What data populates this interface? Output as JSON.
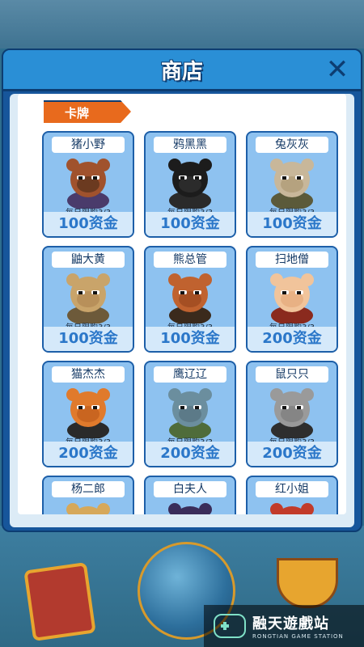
{
  "dialog": {
    "title": "商店",
    "close_glyph": "✕",
    "section_tab": "卡牌"
  },
  "cards": [
    {
      "name": "猪小野",
      "limit": "每日限购3/3",
      "price": "100资金",
      "palette": {
        "skin": "#a0522d",
        "face": "#6b3a20",
        "body": "#4a3b6b"
      }
    },
    {
      "name": "鸦黑黑",
      "limit": "每日限购3/3",
      "price": "100资金",
      "palette": {
        "skin": "#1c1c1c",
        "face": "#2b2b2b",
        "body": "#2a2a2a"
      }
    },
    {
      "name": "兔灰灰",
      "limit": "每日限购3/3",
      "price": "100资金",
      "palette": {
        "skin": "#c8b79a",
        "face": "#b5a27f",
        "body": "#5b5a3a"
      }
    },
    {
      "name": "鼬大黄",
      "limit": "每日限购3/3",
      "price": "100资金",
      "palette": {
        "skin": "#c9a46a",
        "face": "#b8905a",
        "body": "#6d5a3a"
      }
    },
    {
      "name": "熊总管",
      "limit": "每日限购3/3",
      "price": "100资金",
      "palette": {
        "skin": "#c0622f",
        "face": "#a54f23",
        "body": "#3b2a1c"
      }
    },
    {
      "name": "扫地僧",
      "limit": "每日限购3/3",
      "price": "200资金",
      "palette": {
        "skin": "#f1c49b",
        "face": "#e8b184",
        "body": "#8a2a1e"
      }
    },
    {
      "name": "猫杰杰",
      "limit": "每日限购3/3",
      "price": "200资金",
      "palette": {
        "skin": "#e07a2c",
        "face": "#c96520",
        "body": "#2a2a2a"
      }
    },
    {
      "name": "鹰辽辽",
      "limit": "每日限购3/3",
      "price": "200资金",
      "palette": {
        "skin": "#6b8e9e",
        "face": "#5c7a88",
        "body": "#4f6c3a"
      }
    },
    {
      "name": "鼠只只",
      "limit": "每日限购3/3",
      "price": "200资金",
      "palette": {
        "skin": "#9a9a9a",
        "face": "#858585",
        "body": "#2e2e2e"
      }
    },
    {
      "name": "杨二郎",
      "limit": "",
      "price": "",
      "palette": {
        "skin": "#d6a85a",
        "face": "#d6a85a",
        "body": "#3a2d1c"
      }
    },
    {
      "name": "白夫人",
      "limit": "",
      "price": "",
      "palette": {
        "skin": "#3a2d5a",
        "face": "#3a2d5a",
        "body": "#3a2d5a"
      }
    },
    {
      "name": "红小姐",
      "limit": "",
      "price": "",
      "palette": {
        "skin": "#c23b2a",
        "face": "#c23b2a",
        "body": "#c23b2a"
      }
    }
  ],
  "watermark": {
    "cn": "融天遊戲站",
    "en": "RONGTIAN GAME STATION"
  }
}
